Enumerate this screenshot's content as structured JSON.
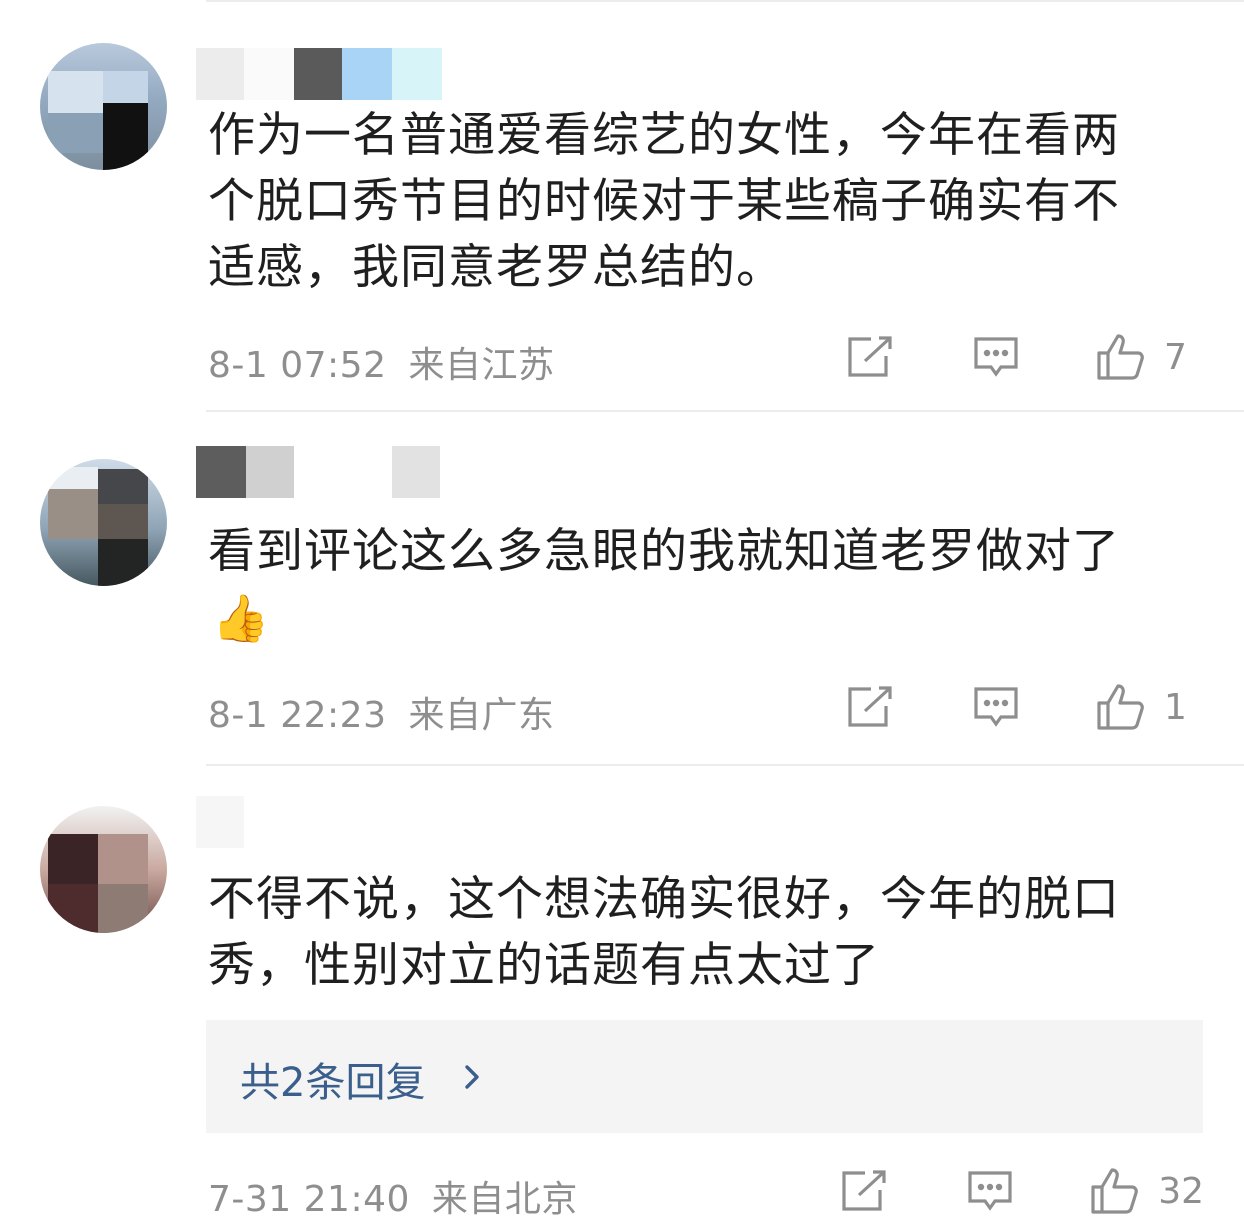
{
  "comments": [
    {
      "text_lines": [
        "作为一名普通爱看综艺的女性，今年在看两",
        "个脱口秀节目的时候对于某些稿子确实有不",
        "适感，我同意老罗总结的。"
      ],
      "date": "8-1 07:52",
      "location": "来自江苏",
      "likes": "7"
    },
    {
      "text_lines": [
        "看到评论这么多急眼的我就知道老罗做对了"
      ],
      "emoji": "👍",
      "date": "8-1 22:23",
      "location": "来自广东",
      "likes": "1"
    },
    {
      "text_lines": [
        "不得不说，这个想法确实很好，今年的脱口",
        "秀，性别对立的话题有点太过了"
      ],
      "replies_label": "共2条回复",
      "date": "7-31 21:40",
      "location": "来自北京",
      "likes": "32"
    }
  ],
  "icons": {
    "share": "share-icon",
    "comment": "comment-icon",
    "like": "thumbs-up-icon",
    "chevron": "chevron-right-icon"
  },
  "colors": {
    "meta_text": "#8e8e8e",
    "reply_link": "#3b5f8c",
    "reply_box_bg": "#f4f4f4"
  }
}
